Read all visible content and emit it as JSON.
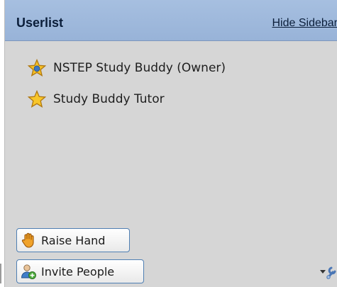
{
  "header": {
    "title": "Userlist",
    "hide_link": "Hide Sidebar"
  },
  "users": [
    {
      "label": "NSTEP Study Buddy (Owner)",
      "icon": "owner-star-icon"
    },
    {
      "label": "Study Buddy Tutor",
      "icon": "star-icon"
    }
  ],
  "buttons": {
    "raise_hand": "Raise Hand",
    "invite_people": "Invite People"
  },
  "colors": {
    "header_bg": "#a6bfe0",
    "panel_bg": "#d6d6d6",
    "button_border": "#4f7fb3"
  }
}
